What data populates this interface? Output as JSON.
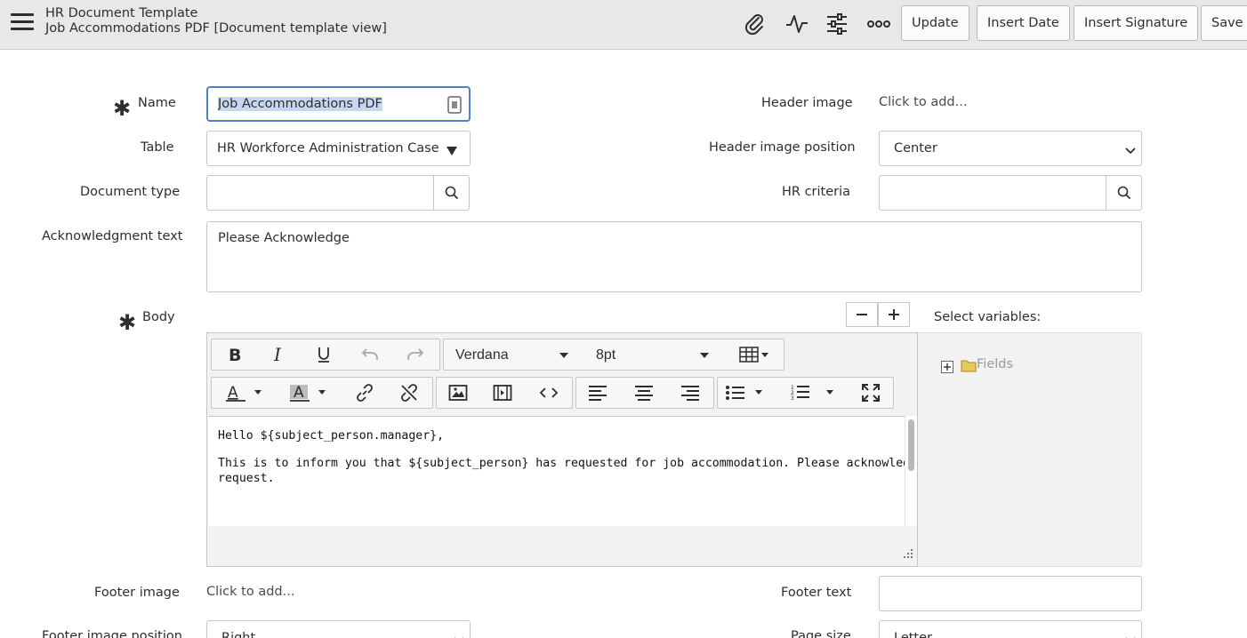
{
  "header": {
    "title": "HR Document Template",
    "subtitle": "Job Accommodations PDF [Document template view]",
    "icons": [
      "paperclip-icon",
      "activity-icon",
      "sliders-icon",
      "more-icon"
    ],
    "buttons": {
      "update": "Update",
      "insert_date": "Insert Date",
      "insert_signature": "Insert Signature",
      "save": "Save"
    }
  },
  "form": {
    "name": {
      "label": "Name",
      "value": "Job Accommodations PDF"
    },
    "table": {
      "label": "Table",
      "value": "HR Workforce Administration Case ..."
    },
    "document_type": {
      "label": "Document type",
      "value": ""
    },
    "acknowledgment_text": {
      "label": "Acknowledgment text",
      "value": "Please Acknowledge"
    },
    "body": {
      "label": "Body"
    },
    "header_image": {
      "label": "Header image",
      "value": "Click to add..."
    },
    "header_image_position": {
      "label": "Header image position",
      "value": "Center"
    },
    "hr_criteria": {
      "label": "HR criteria",
      "value": ""
    },
    "footer_image": {
      "label": "Footer image",
      "value": "Click to add..."
    },
    "footer_text": {
      "label": "Footer text",
      "value": ""
    },
    "footer_image_position": {
      "label": "Footer image position",
      "value": "Right"
    },
    "page_size": {
      "label": "Page size",
      "value": "Letter"
    }
  },
  "editor": {
    "font_family": "Verdana",
    "font_size": "8pt",
    "content": [
      "Hello ${subject_person.manager},",
      "This is to inform you that ${subject_person} has requested for job accommodation. Please acknowledge this",
      "request."
    ]
  },
  "variables": {
    "label": "Select variables:",
    "tree": [
      {
        "label": "Fields"
      }
    ]
  },
  "colors": {
    "header_bg": "#e6e8ea",
    "focus_border": "#4f7fc4",
    "selection": "#c5d8f0"
  }
}
